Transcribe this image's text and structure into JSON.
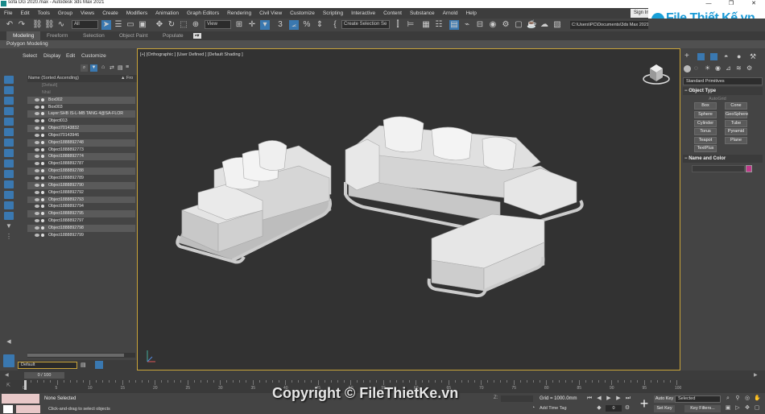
{
  "window": {
    "title": "sofa DG 2020.max - Autodesk 3ds Max 2021",
    "controls": [
      "—",
      "❐",
      "✕"
    ]
  },
  "menubar": {
    "items": [
      "File",
      "Edit",
      "Tools",
      "Group",
      "Views",
      "Create",
      "Modifiers",
      "Animation",
      "Graph Editors",
      "Rendering",
      "Civil View",
      "Customize",
      "Scripting",
      "Interactive",
      "Content",
      "Substance",
      "Arnold",
      "Help"
    ],
    "signin": "Sign In"
  },
  "logo": {
    "text": "File Thiết Kế.vn"
  },
  "toolbar": {
    "filter": "All",
    "coord": "View",
    "selection_set": "Create Selection Se",
    "path": "C:\\Users\\PC\\Documents\\3ds Max 2021"
  },
  "ribbon": {
    "tabs": [
      "Modeling",
      "Freeform",
      "Selection",
      "Object Paint",
      "Populate"
    ],
    "subtab": "Polygon Modeling"
  },
  "explorer": {
    "tabs": [
      "Select",
      "Display",
      "Edit",
      "Customize"
    ],
    "header_name": "Name (Sorted Ascending)",
    "header_col": "▲ Fro",
    "items": [
      "[Default]",
      "Nhàl",
      "Box002",
      "Box003",
      "Layer:SHB IS-L-MB TANG 4@SA-FLOR",
      "Object013",
      "Object70143832",
      "Object70143946",
      "Object1888892748",
      "Object1888892773",
      "Object1888892774",
      "Object1888892787",
      "Object1888892788",
      "Object1888892789",
      "Object1888892790",
      "Object1888892792",
      "Object1888892793",
      "Object1888892794",
      "Object1888892795",
      "Object1888892797",
      "Object1888892798",
      "Object1888892799"
    ],
    "layer": "Default"
  },
  "viewport": {
    "label": "[+] [Orthographic ] [User Defined ] [Default Shading ]"
  },
  "cmdpanel": {
    "dropdown": "Standard Primitives",
    "object_type": "Object Type",
    "autogrid": "AutoGrid",
    "buttons": [
      "Box",
      "Cone",
      "Sphere",
      "GeoSphere",
      "Cylinder",
      "Tube",
      "Torus",
      "Pyramid",
      "Teapot",
      "Plane",
      "TextPlus"
    ],
    "name_color": "Name and Color",
    "accent_color": "#c0398a"
  },
  "timeline": {
    "frame": "0 / 100",
    "ticks": [
      "0",
      "5",
      "10",
      "15",
      "20",
      "25",
      "30",
      "35",
      "40",
      "45",
      "50",
      "55",
      "60",
      "65",
      "70",
      "75",
      "80",
      "85",
      "90",
      "95",
      "100"
    ]
  },
  "status": {
    "selection": "None Selected",
    "prompt": "Click-and-drag to select objects",
    "grid": "Grid = 1000.0mm",
    "add_time_tag": "Add Time Tag",
    "auto_key": "Auto Key",
    "set_key": "Set Key",
    "selected": "Selected",
    "key_filters": "Key Filters...",
    "frame_field": "0",
    "copyright": "Copyright © FileThietKe.vn"
  }
}
